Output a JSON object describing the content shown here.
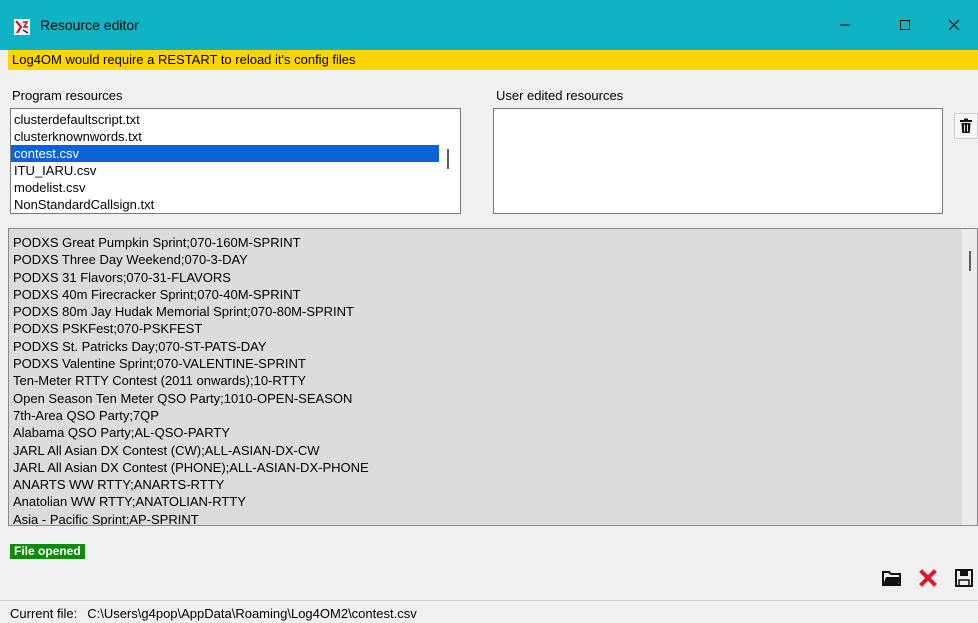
{
  "window": {
    "title": "Resource editor",
    "icons": {
      "app": "log4om-icon",
      "minimize": "minimize-icon",
      "maximize": "maximize-icon",
      "close": "close-icon"
    }
  },
  "warning": {
    "text": "Log4OM would require a RESTART to reload it's config files",
    "color": "#ffd400"
  },
  "program_resources": {
    "label": "Program resources",
    "items": [
      "clusterdefaultscript.txt",
      "clusterknownwords.txt",
      "contest.csv",
      "ITU_IARU.csv",
      "modelist.csv",
      "NonStandardCallsign.txt"
    ],
    "selected": "contest.csv"
  },
  "user_resources": {
    "label": "User edited resources",
    "items": [],
    "delete_icon": "trash-icon"
  },
  "editor": {
    "lines": [
      "PODXS Great Pumpkin Sprint;070-160M-SPRINT",
      "PODXS Three Day Weekend;070-3-DAY",
      "PODXS 31 Flavors;070-31-FLAVORS",
      "PODXS 40m Firecracker Sprint;070-40M-SPRINT",
      "PODXS 80m Jay Hudak Memorial Sprint;070-80M-SPRINT",
      "PODXS PSKFest;070-PSKFEST",
      "PODXS St. Patricks Day;070-ST-PATS-DAY",
      "PODXS Valentine Sprint;070-VALENTINE-SPRINT",
      "Ten-Meter RTTY Contest (2011 onwards);10-RTTY",
      "Open Season Ten Meter QSO Party;1010-OPEN-SEASON",
      "7th-Area QSO Party;7QP",
      "Alabama QSO Party;AL-QSO-PARTY",
      "JARL All Asian DX Contest (CW);ALL-ASIAN-DX-CW",
      "JARL All Asian DX Contest (PHONE);ALL-ASIAN-DX-PHONE",
      "ANARTS WW RTTY;ANARTS-RTTY",
      "Anatolian WW RTTY;ANATOLIAN-RTTY",
      "Asia - Pacific Sprint;AP-SPRINT"
    ]
  },
  "status": {
    "badge": "File opened",
    "badge_color": "#0e8a0e"
  },
  "toolbar": {
    "open_icon": "folder-open-icon",
    "discard_icon": "red-x-icon",
    "save_icon": "floppy-save-icon"
  },
  "footer": {
    "label": "Current file:",
    "path": "C:\\Users\\g4pop\\AppData\\Roaming\\Log4OM2\\contest.csv"
  }
}
